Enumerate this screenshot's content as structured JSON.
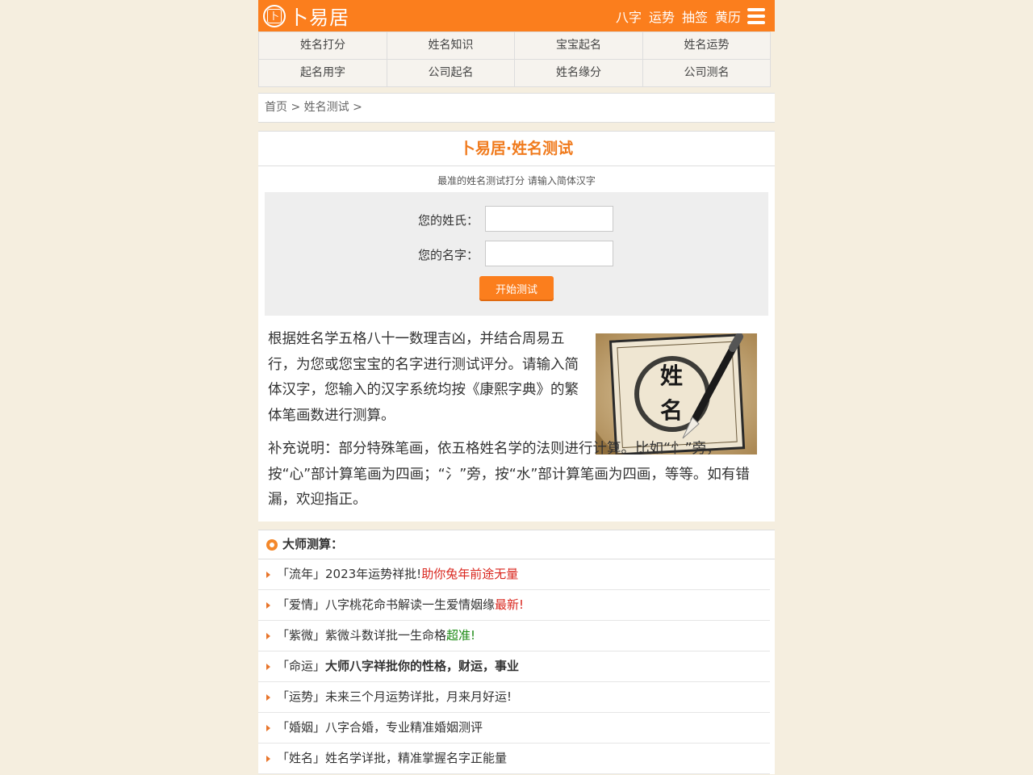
{
  "header": {
    "logo_text": "卜易居",
    "logo_seal": "卜",
    "nav": [
      "八字",
      "运势",
      "抽签",
      "黄历"
    ]
  },
  "grid_nav": [
    "姓名打分",
    "姓名知识",
    "宝宝起名",
    "姓名运势",
    "起名用字",
    "公司起名",
    "姓名缘分",
    "公司测名"
  ],
  "breadcrumb": {
    "home": "首页",
    "sep1": " > ",
    "current": "姓名测试",
    "sep2": " >"
  },
  "tool": {
    "title": "卜易居·姓名测试",
    "subtitle": "最准的姓名测试打分 请输入简体汉字",
    "surname_label": "您的姓氏：",
    "name_label": "您的名字：",
    "surname_value": "",
    "name_value": "",
    "button": "开始测试"
  },
  "intro": {
    "p1": "根据姓名学五格八十一数理吉凶，并结合周易五行，为您或您宝宝的名字进行测试评分。请输入简体汉字，您输入的汉字系统均按《康熙字典》的繁体笔画数进行测算。",
    "p2": "补充说明：部分特殊笔画，依五格姓名学的法则进行计算。比如“忄”旁，按“心”部计算笔画为四画；“氵”旁，按“水”部计算笔画为四画，等等。如有错漏，欢迎指正。",
    "image_chars": [
      "姓",
      "名"
    ]
  },
  "master": {
    "title": "大师测算：",
    "items": [
      {
        "prefix": "「流年」2023年运势祥批! ",
        "highlight": "助你兔年前途无量"
      },
      {
        "prefix": "「爱情」八字桃花命书解读一生爱情姻缘",
        "highlight": "最新!"
      },
      {
        "prefix": "「紫微」紫微斗数详批一生命格 ",
        "highlight": "超准!"
      },
      {
        "prefix": "「命运」",
        "highlight": "大师八字祥批你的性格，财运，事业"
      },
      {
        "prefix": "「运势」未来三个月运势详批，月来月好运!",
        "highlight": ""
      },
      {
        "prefix": "「婚姻」八字合婚，专业精准婚姻测评",
        "highlight": ""
      },
      {
        "prefix": "「姓名」姓名学详批，精准掌握名字正能量",
        "highlight": ""
      }
    ]
  },
  "colors": {
    "brand": "#fb7e1d",
    "title": "#f07a1c",
    "red": "#d9251d",
    "green": "#1c8a14",
    "background": "#f5eedf"
  }
}
